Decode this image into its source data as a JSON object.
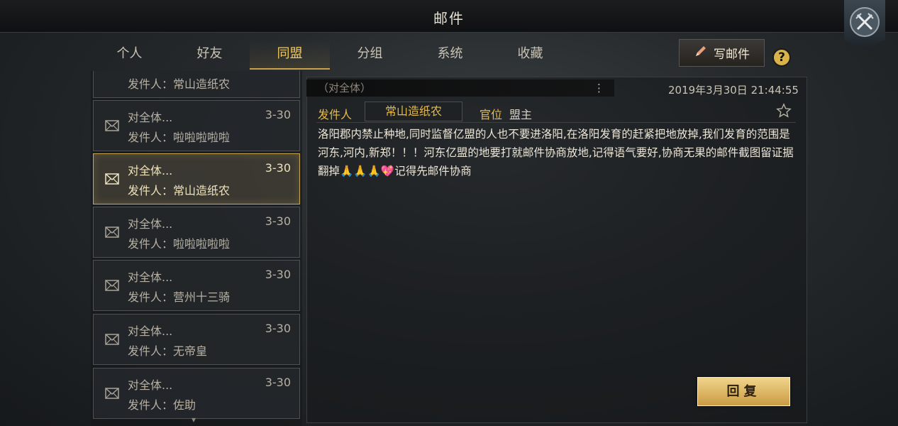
{
  "window": {
    "title": "邮件"
  },
  "tabs": [
    {
      "label": "个人"
    },
    {
      "label": "好友"
    },
    {
      "label": "同盟",
      "active": true
    },
    {
      "label": "分组"
    },
    {
      "label": "系统"
    },
    {
      "label": "收藏"
    }
  ],
  "toolbar": {
    "write_label": "写邮件",
    "help_label": "?"
  },
  "mail_list": {
    "partial_top_sender": "发件人：常山造纸农",
    "items": [
      {
        "subject": "对全体...",
        "date": "3-30",
        "sender": "发件人：啦啦啦啦啦"
      },
      {
        "subject": "对全体...",
        "date": "3-30",
        "sender": "发件人：常山造纸农",
        "active": true
      },
      {
        "subject": "对全体...",
        "date": "3-30",
        "sender": "发件人：啦啦啦啦啦"
      },
      {
        "subject": "对全体...",
        "date": "3-30",
        "sender": "发件人：营州十三骑"
      },
      {
        "subject": "对全体...",
        "date": "3-30",
        "sender": "发件人：无帝皇"
      },
      {
        "subject": "对全体...",
        "date": "3-30",
        "sender": "发件人：佐助"
      }
    ]
  },
  "detail": {
    "recipient": "（对全体）",
    "more_icon": "⋮",
    "timestamp": "2019年3月30日 21:44:55",
    "sender_label": "发件人",
    "sender_name": "常山造纸农",
    "rank_label": "官位",
    "rank_value": "盟主",
    "body": "洛阳郡内禁止种地,同时监督亿盟的人也不要进洛阳,在洛阳发育的赶紧把地放掉,我们发育的范围是河东,河内,新郑！！！河东亿盟的地要打就邮件协商放地,记得语气要好,协商无果的邮件截图留证据翻掉🙏🙏🙏💖记得先邮件协商",
    "reply_label": "回复"
  },
  "colors": {
    "accent": "#f2c85a",
    "gold_button": "#d9b34a"
  }
}
